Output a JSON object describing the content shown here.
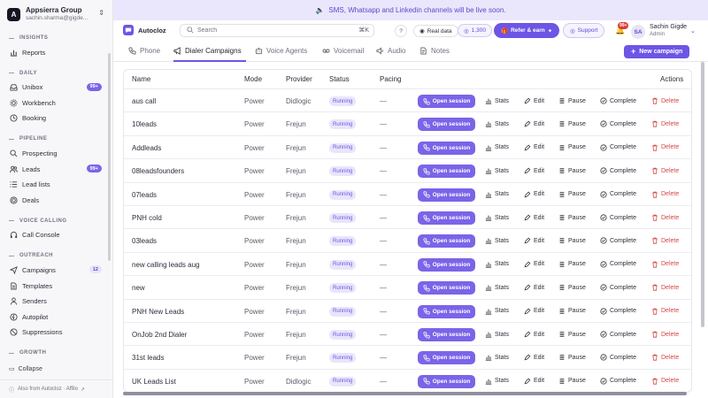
{
  "org": {
    "name": "Appsierra Group",
    "email": "sachin.sharma@gigde...",
    "initial": "A"
  },
  "sidebar": {
    "sections": [
      {
        "label": "INSIGHTS",
        "items": [
          {
            "label": "Reports",
            "icon": "chart-icon"
          }
        ]
      },
      {
        "label": "DAILY",
        "items": [
          {
            "label": "Unibox",
            "icon": "inbox-icon",
            "badge": "99+"
          },
          {
            "label": "Workbench",
            "icon": "gear-icon"
          },
          {
            "label": "Booking",
            "icon": "clock-icon"
          }
        ]
      },
      {
        "label": "PIPELINE",
        "items": [
          {
            "label": "Prospecting",
            "icon": "search-icon"
          },
          {
            "label": "Leads",
            "icon": "users-icon",
            "badge": "99+"
          },
          {
            "label": "Lead lists",
            "icon": "list-icon"
          },
          {
            "label": "Deals",
            "icon": "target-icon"
          }
        ]
      },
      {
        "label": "VOICE CALLING",
        "items": [
          {
            "label": "Call Console",
            "icon": "headset-icon"
          }
        ]
      },
      {
        "label": "OUTREACH",
        "items": [
          {
            "label": "Campaigns",
            "icon": "send-icon",
            "badge": "12"
          },
          {
            "label": "Templates",
            "icon": "document-icon"
          },
          {
            "label": "Senders",
            "icon": "user-icon"
          },
          {
            "label": "Autopilot",
            "icon": "bolt-icon"
          },
          {
            "label": "Suppressions",
            "icon": "ban-icon"
          }
        ]
      },
      {
        "label": "GROWTH",
        "items": []
      }
    ],
    "collapse_label": "Collapse",
    "footer": "Also from Autocloz · Affilo"
  },
  "banner": {
    "text": "SMS, Whatsapp and Linkedin channels will be live soon."
  },
  "topbar": {
    "brand": "Autocloz",
    "search_placeholder": "Search",
    "search_shortcut": "⌘K",
    "help": "?",
    "realdata": "Real data",
    "credits": "1,300",
    "refer": "Refer & earn",
    "support": "Support",
    "notif_badge": "99+",
    "user_initials": "SA",
    "user_name": "Sachin Gigde",
    "user_role": "Admin"
  },
  "tabs": [
    {
      "label": "Phone",
      "icon": "phone-icon"
    },
    {
      "label": "Dialer Campaigns",
      "icon": "megaphone-icon",
      "active": true
    },
    {
      "label": "Voice Agents",
      "icon": "bot-icon"
    },
    {
      "label": "Voicemail",
      "icon": "voicemail-icon"
    },
    {
      "label": "Audio",
      "icon": "audio-icon"
    },
    {
      "label": "Notes",
      "icon": "note-icon"
    }
  ],
  "new_campaign_label": "New campaign",
  "table": {
    "headers": {
      "name": "Name",
      "mode": "Mode",
      "provider": "Provider",
      "status": "Status",
      "pacing": "Pacing",
      "actions": "Actions"
    },
    "action_labels": {
      "open": "Open session",
      "stats": "Stats",
      "edit": "Edit",
      "pause": "Pause",
      "complete": "Complete",
      "delete": "Delete"
    },
    "rows": [
      {
        "name": "aus call",
        "mode": "Power",
        "provider": "Didlogic",
        "status": "Running",
        "pacing": "—"
      },
      {
        "name": "10leads",
        "mode": "Power",
        "provider": "Frejun",
        "status": "Running",
        "pacing": "—"
      },
      {
        "name": "Addleads",
        "mode": "Power",
        "provider": "Frejun",
        "status": "Running",
        "pacing": "—"
      },
      {
        "name": "08leadsfounders",
        "mode": "Power",
        "provider": "Frejun",
        "status": "Running",
        "pacing": "—"
      },
      {
        "name": "07leads",
        "mode": "Power",
        "provider": "Frejun",
        "status": "Running",
        "pacing": "—"
      },
      {
        "name": "PNH cold",
        "mode": "Power",
        "provider": "Frejun",
        "status": "Running",
        "pacing": "—"
      },
      {
        "name": "03leads",
        "mode": "Power",
        "provider": "Frejun",
        "status": "Running",
        "pacing": "—"
      },
      {
        "name": "new calling leads aug",
        "mode": "Power",
        "provider": "Frejun",
        "status": "Running",
        "pacing": "—"
      },
      {
        "name": "new",
        "mode": "Power",
        "provider": "Frejun",
        "status": "Running",
        "pacing": "—"
      },
      {
        "name": "PNH New Leads",
        "mode": "Power",
        "provider": "Frejun",
        "status": "Running",
        "pacing": "—"
      },
      {
        "name": "OnJob 2nd Dialer",
        "mode": "Power",
        "provider": "Frejun",
        "status": "Running",
        "pacing": "—"
      },
      {
        "name": "31st leads",
        "mode": "Power",
        "provider": "Frejun",
        "status": "Running",
        "pacing": "—"
      },
      {
        "name": "UK Leads List",
        "mode": "Power",
        "provider": "Didlogic",
        "status": "Running",
        "pacing": "—"
      }
    ]
  }
}
